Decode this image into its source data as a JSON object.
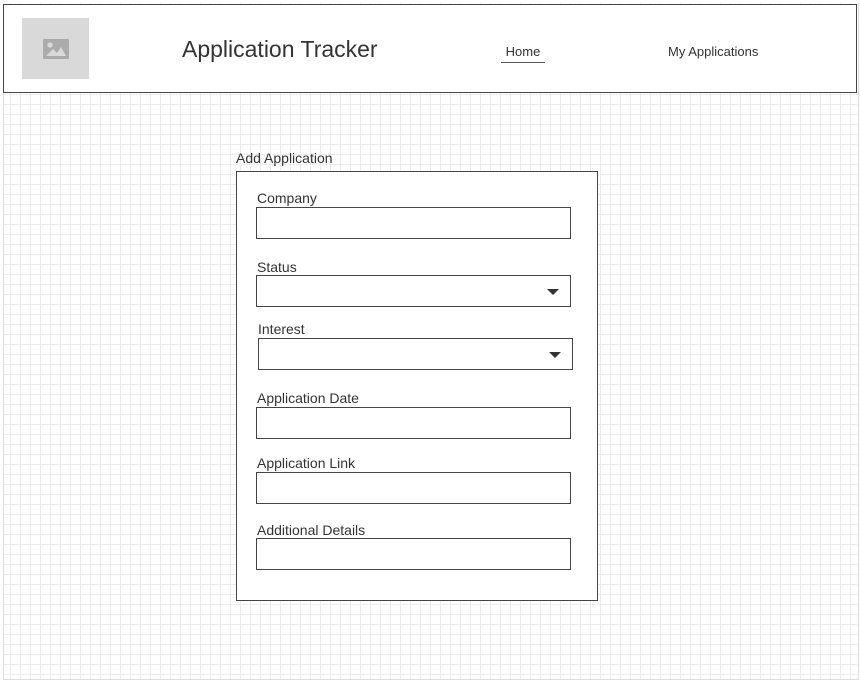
{
  "header": {
    "logo_icon": "image-placeholder-icon",
    "title": "Application Tracker",
    "nav": {
      "home": "Home",
      "my_applications": "My Applications"
    }
  },
  "form": {
    "heading": "Add Application",
    "company_label": "Company",
    "company_value": "",
    "status_label": "Status",
    "status_value": "",
    "interest_label": "Interest",
    "interest_value": "",
    "date_label": "Application Date",
    "date_value": "",
    "link_label": "Application Link",
    "link_value": "",
    "details_label": "Additional Details",
    "details_value": ""
  }
}
